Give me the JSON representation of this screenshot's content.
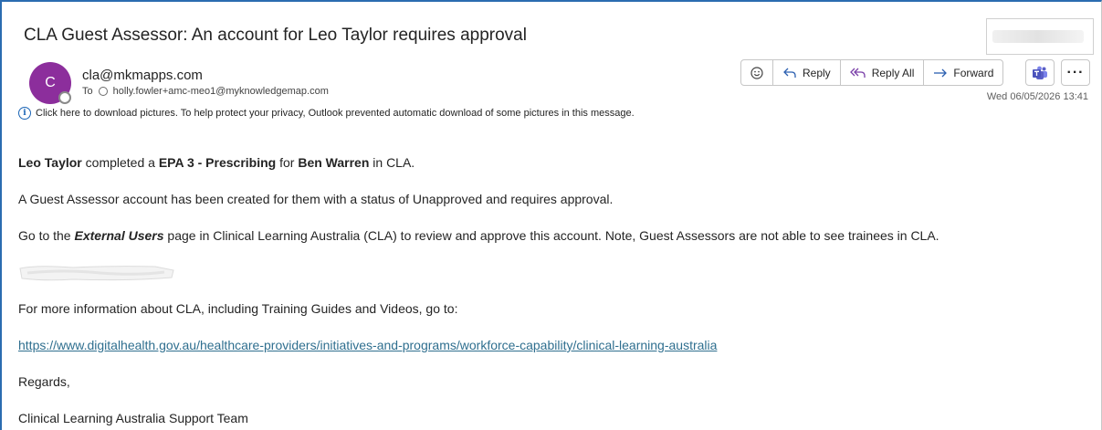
{
  "email": {
    "subject": "CLA Guest Assessor: An account for Leo Taylor requires approval",
    "avatar_initial": "C",
    "sender": "cla@mkmapps.com",
    "to_label": "To",
    "to_address": "holly.fowler+amc-meo1@myknowledgemap.com",
    "info_notice": "Click here to download pictures. To help protect your privacy, Outlook prevented automatic download of some pictures in this message.",
    "date": "Wed 06/05/2026 13:41"
  },
  "toolbar": {
    "emoji_icon": "smiley-icon",
    "reply_label": "Reply",
    "reply_all_label": "Reply All",
    "forward_label": "Forward",
    "more_label": "···"
  },
  "body": {
    "line1": {
      "assessor": "Leo Taylor",
      "mid1": " completed a ",
      "activity": "EPA 3 - Prescribing",
      "mid2": " for ",
      "trainee": "Ben Warren",
      "end": " in CLA."
    },
    "line2": "A Guest Assessor account has been created for them with a status of Unapproved and requires approval.",
    "line3": {
      "start": "Go to the ",
      "page": "External Users",
      "end": " page in Clinical Learning Australia (CLA) to review and approve this account. Note, Guest Assessors are not able to see trainees in CLA."
    },
    "line4": "For more information about CLA, including Training Guides and Videos, go to:",
    "link": "https://www.digitalhealth.gov.au/healthcare-providers/initiatives-and-programs/workforce-capability/clinical-learning-australia",
    "regards": "Regards,",
    "signature": "Clinical Learning Australia Support Team"
  }
}
